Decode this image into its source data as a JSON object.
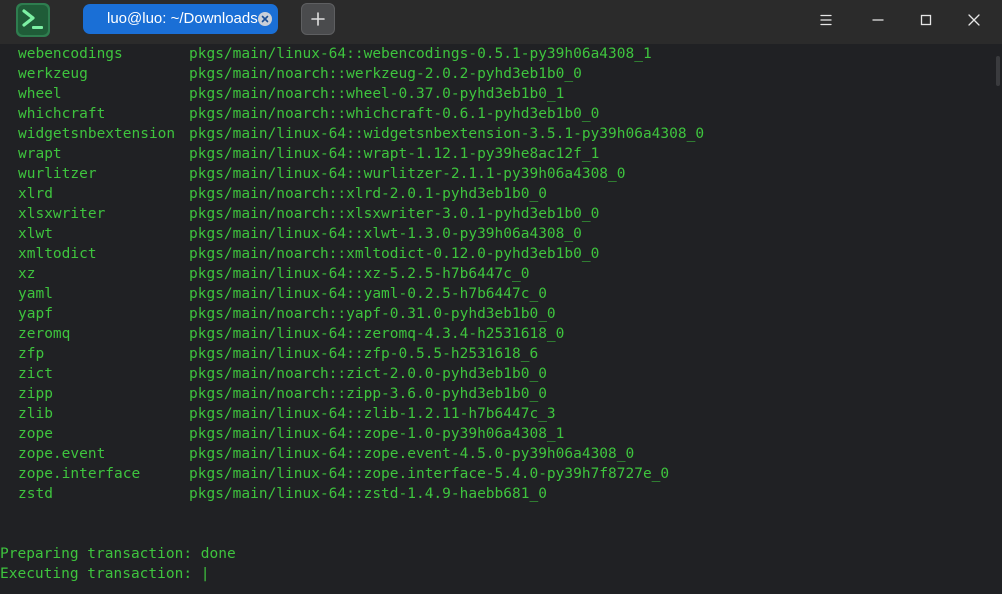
{
  "window": {
    "tab_title": "luo@luo: ~/Downloads",
    "new_tab_label": "+"
  },
  "colors": {
    "terminal_text": "#3ec43e",
    "background": "#202124",
    "tab_active": "#1a6fd6"
  },
  "icons": {
    "app": "terminal-app-icon",
    "tab_close": "close-icon",
    "new_tab": "plus-icon",
    "menu": "hamburger-menu-icon",
    "minimize": "minimize-icon",
    "maximize": "maximize-icon",
    "close": "close-icon"
  },
  "packages": [
    {
      "name": "webencodings",
      "spec": "pkgs/main/linux-64::webencodings-0.5.1-py39h06a4308_1"
    },
    {
      "name": "werkzeug",
      "spec": "pkgs/main/noarch::werkzeug-2.0.2-pyhd3eb1b0_0"
    },
    {
      "name": "wheel",
      "spec": "pkgs/main/noarch::wheel-0.37.0-pyhd3eb1b0_1"
    },
    {
      "name": "whichcraft",
      "spec": "pkgs/main/noarch::whichcraft-0.6.1-pyhd3eb1b0_0"
    },
    {
      "name": "widgetsnbextension",
      "spec": "pkgs/main/linux-64::widgetsnbextension-3.5.1-py39h06a4308_0"
    },
    {
      "name": "wrapt",
      "spec": "pkgs/main/linux-64::wrapt-1.12.1-py39he8ac12f_1"
    },
    {
      "name": "wurlitzer",
      "spec": "pkgs/main/linux-64::wurlitzer-2.1.1-py39h06a4308_0"
    },
    {
      "name": "xlrd",
      "spec": "pkgs/main/noarch::xlrd-2.0.1-pyhd3eb1b0_0"
    },
    {
      "name": "xlsxwriter",
      "spec": "pkgs/main/noarch::xlsxwriter-3.0.1-pyhd3eb1b0_0"
    },
    {
      "name": "xlwt",
      "spec": "pkgs/main/linux-64::xlwt-1.3.0-py39h06a4308_0"
    },
    {
      "name": "xmltodict",
      "spec": "pkgs/main/noarch::xmltodict-0.12.0-pyhd3eb1b0_0"
    },
    {
      "name": "xz",
      "spec": "pkgs/main/linux-64::xz-5.2.5-h7b6447c_0"
    },
    {
      "name": "yaml",
      "spec": "pkgs/main/linux-64::yaml-0.2.5-h7b6447c_0"
    },
    {
      "name": "yapf",
      "spec": "pkgs/main/noarch::yapf-0.31.0-pyhd3eb1b0_0"
    },
    {
      "name": "zeromq",
      "spec": "pkgs/main/linux-64::zeromq-4.3.4-h2531618_0"
    },
    {
      "name": "zfp",
      "spec": "pkgs/main/linux-64::zfp-0.5.5-h2531618_6"
    },
    {
      "name": "zict",
      "spec": "pkgs/main/noarch::zict-2.0.0-pyhd3eb1b0_0"
    },
    {
      "name": "zipp",
      "spec": "pkgs/main/noarch::zipp-3.6.0-pyhd3eb1b0_0"
    },
    {
      "name": "zlib",
      "spec": "pkgs/main/linux-64::zlib-1.2.11-h7b6447c_3"
    },
    {
      "name": "zope",
      "spec": "pkgs/main/linux-64::zope-1.0-py39h06a4308_1"
    },
    {
      "name": "zope.event",
      "spec": "pkgs/main/linux-64::zope.event-4.5.0-py39h06a4308_0"
    },
    {
      "name": "zope.interface",
      "spec": "pkgs/main/linux-64::zope.interface-5.4.0-py39h7f8727e_0"
    },
    {
      "name": "zstd",
      "spec": "pkgs/main/linux-64::zstd-1.4.9-haebb681_0"
    }
  ],
  "status": {
    "preparing": "Preparing transaction: done",
    "executing": "Executing transaction: ",
    "cursor": "|"
  }
}
